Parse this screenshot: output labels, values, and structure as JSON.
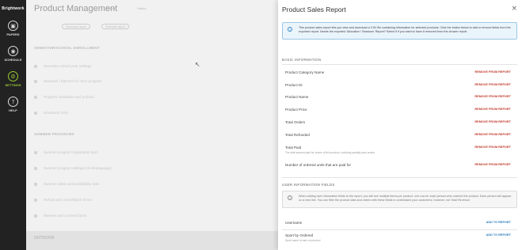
{
  "nav": {
    "brand": "Brightwork",
    "items": [
      {
        "label": "PAPERS",
        "icon": "clipboard-icon",
        "glyph": "▣",
        "active": false
      },
      {
        "label": "SCHEDULE",
        "icon": "calendar-icon",
        "glyph": "◉",
        "active": false
      },
      {
        "label": "SETTINGS",
        "icon": "settings-icon",
        "glyph": "⚙",
        "active": true
      },
      {
        "label": "HELP",
        "icon": "help-icon",
        "glyph": "?",
        "active": false
      }
    ]
  },
  "background": {
    "title": "Product Management",
    "tabs": [
      "Details",
      "Status"
    ],
    "buttons": [
      "Download report",
      "Schedule report"
    ],
    "section1": "SEMESTER/SCHOOL ENROLLMENT",
    "section1_items": [
      "Semester school year settings",
      "Sessions / batches for each program",
      "Program schedules and policies",
      "Enrolment form"
    ],
    "section2": "SUMMER PROGRAMS",
    "section2_items": [
      "Summer program registration form",
      "Summer program settings (multi-language)",
      "Summer dates and availability slots",
      "Refund and cancellation terms",
      "Waivers and consent forms"
    ],
    "footer": "OUTDOOR"
  },
  "drawer": {
    "title": "Product Sales Report",
    "close": "×",
    "info_text": "This product sales report lets you view and download a CSV file containing information for selected products. Click the button below to add or remove fields from the exported report. Needs the exported 'Allocation / Sessions' Report? Select it if you want to have it removed from the chosen report.",
    "basic_section": "BASIC INFORMATION",
    "basic_fields": [
      {
        "label": "Product Category Name",
        "action": "REMOVE FROM REPORT",
        "sub": ""
      },
      {
        "label": "Product ID",
        "action": "REMOVE FROM REPORT",
        "sub": ""
      },
      {
        "label": "Product Name",
        "action": "REMOVE FROM REPORT",
        "sub": ""
      },
      {
        "label": "Product Price",
        "action": "REMOVE FROM REPORT",
        "sub": ""
      },
      {
        "label": "Total Orders",
        "action": "REMOVE FROM REPORT",
        "sub": ""
      },
      {
        "label": "Total Refunded",
        "action": "REMOVE FROM REPORT",
        "sub": ""
      },
      {
        "label": "Total Paid",
        "action": "REMOVE FROM REPORT",
        "sub": "The total amount paid for orders of this product, including partially paid orders"
      },
      {
        "label": "Number of ordered units that are paid for",
        "action": "REMOVE FROM REPORT",
        "sub": ""
      }
    ],
    "user_section": "USER INFORMATION FIELDS",
    "user_info_text": "When adding user information fields to the report, you will see multiple items per product, one row for each person who ordered the product. Each person will appear on a new line. You can filter the product data and orders with these fields to understand your customers, however, not Total Revenue.",
    "user_fields": [
      {
        "label": "Username",
        "action": "ADD TO REPORT",
        "sub": ""
      },
      {
        "label": "Sport by Ordered",
        "action": "ADD TO REPORT",
        "sub": "Sport name of user on product"
      }
    ]
  }
}
